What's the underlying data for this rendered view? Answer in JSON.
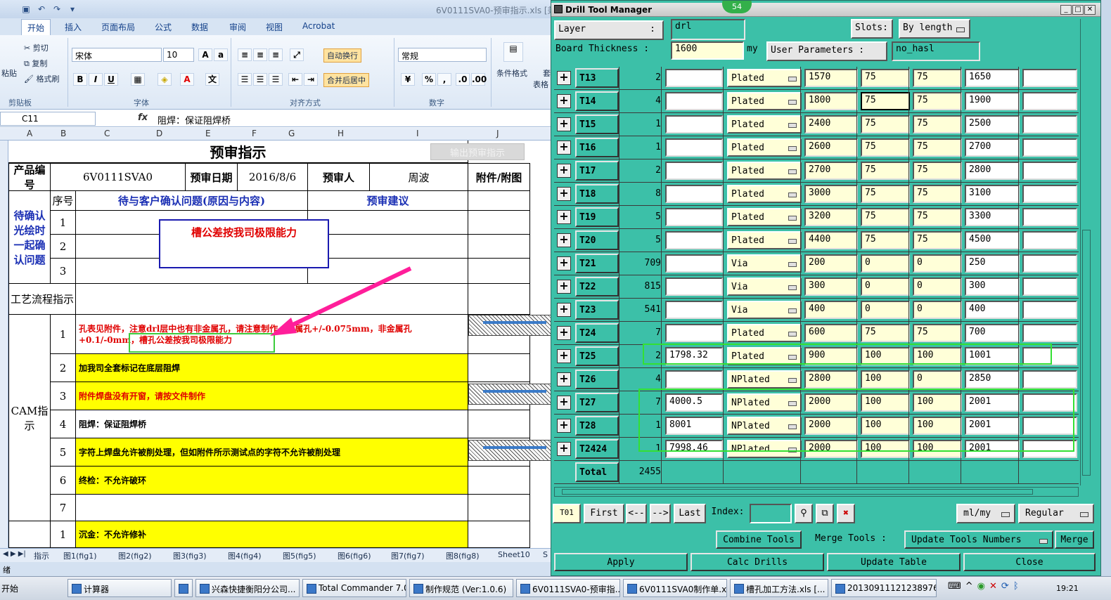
{
  "excel": {
    "title": "6V0111SVA0-预审指示.xls [兼",
    "tabs": [
      "开始",
      "插入",
      "页面布局",
      "公式",
      "数据",
      "审阅",
      "视图",
      "Acrobat"
    ],
    "ribbon": {
      "clipboard_label": "剪贴板",
      "cut": "剪切",
      "copy": "复制",
      "paste": "粘贴",
      "format_painter": "格式刷",
      "font_name": "宋体",
      "font_size": "10",
      "font_label": "字体",
      "wrap_text": "自动换行",
      "merge_center": "合并后居中",
      "align_label": "对齐方式",
      "number_format": "常规",
      "number_label": "数字",
      "cond_format": "条件格式",
      "table_style": "表格",
      "style_partial": "套"
    },
    "name_box": "C11",
    "formula": "阻焊：保证阻焊桥",
    "columns": [
      "A",
      "B",
      "C",
      "D",
      "E",
      "F",
      "G",
      "H",
      "I",
      "J"
    ],
    "sheet": {
      "title": "预审指示",
      "export_button": "输出预审指示",
      "product_label": "产品编号",
      "product_code": "6V0111SVA0",
      "review_date_label": "预审日期",
      "review_date": "2016/8/6",
      "reviewer_label": "预审人",
      "reviewer": "周波",
      "attachment_label": "附件/附图",
      "seq_label": "序号",
      "confirm_header": "待与客户确认问题(原因与内容)",
      "suggest_header": "预审建议",
      "pending_label": "待确认光绘时一起确认问题",
      "pending_rows": [
        "1",
        "2",
        "3"
      ],
      "process_label": "工艺流程指示",
      "cam_label": "CAM指示",
      "cam_rows": [
        {
          "no": "1",
          "text": "孔表见附件，注意drl层中也有非金属孔，请注意制作，金属孔+/-0.075mm，非金属孔+0.1/-0mm，槽孔公差按我司极限能力"
        },
        {
          "no": "2",
          "text": "加我司全套标记在底层阻焊"
        },
        {
          "no": "3",
          "text": "附件焊盘没有开窗，请按文件制作"
        },
        {
          "no": "4",
          "text": "阻焊：保证阻焊桥"
        },
        {
          "no": "5",
          "text": "字符上焊盘允许被削处理，但如附件所示测试点的字符不允许被削处理"
        },
        {
          "no": "6",
          "text": "终检：不允许破环"
        },
        {
          "no": "7",
          "text": ""
        }
      ],
      "next_row": {
        "no": "1",
        "text": "沉金：不允许修补"
      },
      "callout": "槽公差按我司极限能力",
      "callout_inline": "槽孔公差按我司极限能力"
    },
    "sheet_tabs": [
      "指示",
      "图1(fig1)",
      "图2(fig2)",
      "图3(fig3)",
      "图4(fig4)",
      "图5(fig5)",
      "图6(fig6)",
      "图7(fig7)",
      "图8(fig8)",
      "Sheet10",
      "S"
    ],
    "status": "绪"
  },
  "dtm": {
    "title": "Drill Tool Manager",
    "badge": "54",
    "layer_label": "Layer",
    "layer_sep": ":",
    "layer_value": "drl",
    "slots_label": "Slots:",
    "slots_value": "By length",
    "board_thickness_label": "Board Thickness :",
    "board_thickness_value": "1600",
    "board_thickness_unit": "my",
    "user_params_label": "User Parameters :",
    "user_params_value": "no_hasl",
    "tools": [
      {
        "name": "T13",
        "count": "2",
        "drill": "",
        "type": "Plated",
        "finish": "1570",
        "tol_plus": "75",
        "tol_minus": "75",
        "size": "1650",
        "extra": ""
      },
      {
        "name": "T14",
        "count": "4",
        "drill": "",
        "type": "Plated",
        "finish": "1800",
        "tol_plus": "75",
        "tol_minus": "75",
        "size": "1900",
        "extra": ""
      },
      {
        "name": "T15",
        "count": "1",
        "drill": "",
        "type": "Plated",
        "finish": "2400",
        "tol_plus": "75",
        "tol_minus": "75",
        "size": "2500",
        "extra": ""
      },
      {
        "name": "T16",
        "count": "1",
        "drill": "",
        "type": "Plated",
        "finish": "2600",
        "tol_plus": "75",
        "tol_minus": "75",
        "size": "2700",
        "extra": ""
      },
      {
        "name": "T17",
        "count": "2",
        "drill": "",
        "type": "Plated",
        "finish": "2700",
        "tol_plus": "75",
        "tol_minus": "75",
        "size": "2800",
        "extra": ""
      },
      {
        "name": "T18",
        "count": "8",
        "drill": "",
        "type": "Plated",
        "finish": "3000",
        "tol_plus": "75",
        "tol_minus": "75",
        "size": "3100",
        "extra": ""
      },
      {
        "name": "T19",
        "count": "5",
        "drill": "",
        "type": "Plated",
        "finish": "3200",
        "tol_plus": "75",
        "tol_minus": "75",
        "size": "3300",
        "extra": ""
      },
      {
        "name": "T20",
        "count": "5",
        "drill": "",
        "type": "Plated",
        "finish": "4400",
        "tol_plus": "75",
        "tol_minus": "75",
        "size": "4500",
        "extra": ""
      },
      {
        "name": "T21",
        "count": "709",
        "drill": "",
        "type": "Via",
        "finish": "200",
        "tol_plus": "0",
        "tol_minus": "0",
        "size": "250",
        "extra": ""
      },
      {
        "name": "T22",
        "count": "815",
        "drill": "",
        "type": "Via",
        "finish": "300",
        "tol_plus": "0",
        "tol_minus": "0",
        "size": "300",
        "extra": ""
      },
      {
        "name": "T23",
        "count": "541",
        "drill": "",
        "type": "Via",
        "finish": "400",
        "tol_plus": "0",
        "tol_minus": "0",
        "size": "400",
        "extra": ""
      },
      {
        "name": "T24",
        "count": "7",
        "drill": "",
        "type": "Plated",
        "finish": "600",
        "tol_plus": "75",
        "tol_minus": "75",
        "size": "700",
        "extra": ""
      },
      {
        "name": "T25",
        "count": "2",
        "drill": "1798.32",
        "type": "Plated",
        "finish": "900",
        "tol_plus": "100",
        "tol_minus": "100",
        "size": "1001",
        "extra": ""
      },
      {
        "name": "T26",
        "count": "4",
        "drill": "",
        "type": "NPlated",
        "finish": "2800",
        "tol_plus": "100",
        "tol_minus": "0",
        "size": "2850",
        "extra": ""
      },
      {
        "name": "T27",
        "count": "7",
        "drill": "4000.5",
        "type": "NPlated",
        "finish": "2000",
        "tol_plus": "100",
        "tol_minus": "100",
        "size": "2001",
        "extra": ""
      },
      {
        "name": "T28",
        "count": "1",
        "drill": "8001",
        "type": "NPlated",
        "finish": "2000",
        "tol_plus": "100",
        "tol_minus": "100",
        "size": "2001",
        "extra": ""
      },
      {
        "name": "T2424",
        "count": "1",
        "drill": "7998.46",
        "type": "NPlated",
        "finish": "2000",
        "tol_plus": "100",
        "tol_minus": "100",
        "size": "2001",
        "extra": ""
      }
    ],
    "total_label": "Total",
    "total_value": "2455",
    "nav": {
      "current": "T01",
      "first": "First",
      "prev": "<--",
      "next": "-->",
      "last": "Last",
      "index_label": "Index:",
      "index_value": "",
      "units": "ml/my",
      "mode": "Regular"
    },
    "buttons": {
      "combine": "Combine Tools",
      "merge_tools": "Merge Tools :",
      "update_numbers": "Update Tools Numbers",
      "merge": "Merge",
      "apply": "Apply",
      "calc": "Calc Drills",
      "update_table": "Update Table",
      "close": "Close"
    }
  },
  "taskbar": {
    "start": "开始",
    "items": [
      "计算器",
      "兴森快捷衡阳分公司...",
      "Total Commander 7.0 ...",
      "制作规范 (Ver:1.0.6)",
      "6V0111SVA0-预审指...",
      "6V0111SVA0制作单.xl...",
      "槽孔加工方法.xls [...",
      "20130911121238976.r..."
    ],
    "clock": "19:21"
  }
}
